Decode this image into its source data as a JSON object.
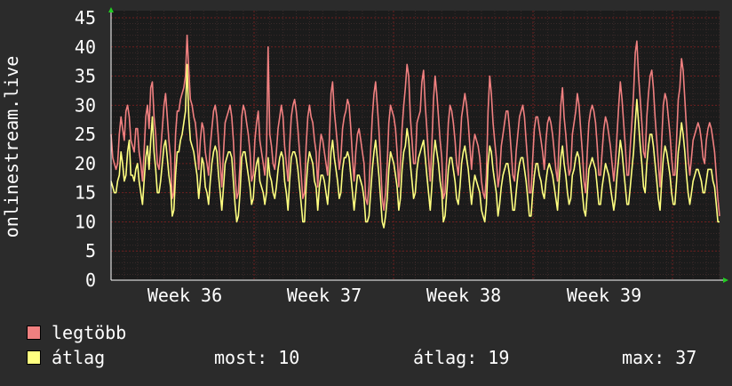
{
  "chart_data": {
    "type": "line",
    "ylabel": "onlinestream.live",
    "ylim": [
      0,
      45
    ],
    "yticks": [
      0,
      5,
      10,
      15,
      20,
      25,
      30,
      35,
      40,
      45
    ],
    "x_labels": [
      "Week 36",
      "Week 37",
      "Week 38",
      "Week 39"
    ],
    "grid": true,
    "colors": {
      "background": "#2b2b2b",
      "plot_background": "#1b1b1b",
      "major_grid": "#6e1f1f",
      "minor_grid": "#3a2a2a",
      "axis": "#ffffff",
      "axis_arrow": "#22cc22",
      "max_series": "#f08080",
      "avg_series": "#ffff80"
    },
    "series": [
      {
        "name": "legtöbb",
        "color": "#f08080",
        "values": [
          25,
          21,
          20,
          19,
          20,
          25,
          28,
          26,
          24,
          29,
          30,
          28,
          24,
          23,
          22,
          26,
          26,
          22,
          20,
          17,
          22,
          28,
          30,
          26,
          33,
          34,
          28,
          25,
          20,
          19,
          22,
          26,
          30,
          32,
          28,
          24,
          21,
          14,
          15,
          25,
          29,
          29,
          31,
          32,
          33,
          35,
          42,
          36,
          31,
          30,
          28,
          27,
          24,
          19,
          24,
          27,
          26,
          22,
          20,
          18,
          23,
          26,
          29,
          30,
          28,
          24,
          20,
          16,
          22,
          27,
          28,
          29,
          30,
          28,
          24,
          18,
          14,
          15,
          20,
          28,
          30,
          29,
          27,
          25,
          22,
          17,
          18,
          24,
          27,
          29,
          24,
          22,
          20,
          18,
          22,
          40,
          25,
          23,
          20,
          19,
          22,
          26,
          28,
          30,
          28,
          23,
          20,
          17,
          23,
          28,
          30,
          31,
          29,
          26,
          22,
          18,
          14,
          15,
          23,
          28,
          30,
          28,
          27,
          24,
          22,
          16,
          22,
          25,
          24,
          22,
          20,
          18,
          24,
          32,
          34,
          29,
          26,
          23,
          19,
          21,
          26,
          28,
          29,
          31,
          30,
          26,
          21,
          17,
          22,
          25,
          26,
          24,
          22,
          20,
          14,
          13,
          16,
          22,
          28,
          32,
          34,
          30,
          26,
          20,
          14,
          12,
          15,
          20,
          27,
          30,
          29,
          28,
          26,
          22,
          16,
          20,
          26,
          30,
          33,
          37,
          35,
          28,
          24,
          20,
          20,
          27,
          28,
          29,
          34,
          36,
          30,
          26,
          21,
          17,
          23,
          31,
          35,
          32,
          28,
          24,
          21,
          14,
          15,
          21,
          27,
          30,
          29,
          27,
          24,
          20,
          18,
          23,
          28,
          30,
          32,
          30,
          27,
          23,
          19,
          23,
          25,
          24,
          23,
          21,
          17,
          15,
          14,
          18,
          29,
          35,
          32,
          27,
          24,
          21,
          16,
          18,
          23,
          25,
          27,
          29,
          29,
          26,
          22,
          18,
          17,
          22,
          25,
          28,
          29,
          30,
          28,
          24,
          20,
          15,
          15,
          21,
          26,
          28,
          28,
          26,
          24,
          22,
          19,
          24,
          27,
          28,
          27,
          25,
          22,
          19,
          17,
          24,
          30,
          33,
          28,
          25,
          21,
          18,
          19,
          25,
          27,
          29,
          32,
          30,
          26,
          22,
          17,
          15,
          22,
          27,
          29,
          30,
          29,
          27,
          23,
          18,
          18,
          22,
          26,
          28,
          27,
          25,
          23,
          20,
          17,
          20,
          25,
          30,
          34,
          31,
          27,
          23,
          18,
          18,
          23,
          27,
          32,
          39,
          41,
          35,
          31,
          27,
          22,
          21,
          28,
          32,
          35,
          36,
          33,
          28,
          24,
          20,
          16,
          24,
          30,
          32,
          31,
          28,
          25,
          21,
          18,
          18,
          24,
          31,
          33,
          38,
          36,
          31,
          26,
          21,
          18,
          21,
          24,
          25,
          26,
          27,
          26,
          24,
          21,
          20,
          24,
          26,
          27,
          26,
          24,
          22,
          18,
          14,
          11
        ]
      },
      {
        "name": "átlag",
        "color": "#ffff80",
        "values": [
          17,
          16,
          15,
          15,
          17,
          18,
          22,
          20,
          17,
          18,
          22,
          24,
          18,
          18,
          17,
          19,
          20,
          17,
          15,
          13,
          17,
          21,
          23,
          19,
          24,
          28,
          22,
          19,
          15,
          15,
          17,
          20,
          23,
          24,
          21,
          18,
          16,
          11,
          12,
          18,
          22,
          22,
          24,
          25,
          27,
          29,
          37,
          28,
          24,
          23,
          22,
          20,
          18,
          14,
          17,
          21,
          20,
          16,
          15,
          13,
          17,
          20,
          22,
          23,
          22,
          18,
          15,
          12,
          16,
          20,
          21,
          22,
          22,
          21,
          17,
          13,
          10,
          11,
          15,
          21,
          22,
          22,
          20,
          18,
          16,
          13,
          14,
          18,
          20,
          21,
          17,
          16,
          15,
          13,
          15,
          21,
          18,
          17,
          15,
          14,
          16,
          19,
          21,
          22,
          21,
          17,
          15,
          12,
          17,
          21,
          22,
          22,
          21,
          19,
          16,
          13,
          10,
          10,
          16,
          20,
          22,
          21,
          20,
          17,
          16,
          12,
          16,
          18,
          18,
          17,
          15,
          13,
          17,
          22,
          24,
          21,
          19,
          17,
          14,
          15,
          19,
          21,
          21,
          22,
          21,
          18,
          15,
          12,
          15,
          18,
          18,
          17,
          16,
          14,
          10,
          10,
          11,
          15,
          19,
          22,
          24,
          21,
          18,
          14,
          10,
          9,
          11,
          14,
          19,
          22,
          21,
          20,
          18,
          16,
          12,
          14,
          19,
          22,
          23,
          26,
          24,
          20,
          17,
          14,
          15,
          19,
          21,
          22,
          23,
          24,
          21,
          18,
          15,
          12,
          16,
          21,
          24,
          22,
          20,
          17,
          15,
          10,
          11,
          15,
          19,
          21,
          21,
          19,
          17,
          14,
          13,
          16,
          20,
          22,
          23,
          21,
          19,
          16,
          13,
          16,
          18,
          17,
          16,
          15,
          12,
          11,
          10,
          13,
          20,
          23,
          22,
          19,
          17,
          15,
          11,
          13,
          16,
          18,
          19,
          20,
          20,
          18,
          15,
          12,
          12,
          15,
          18,
          20,
          21,
          21,
          19,
          17,
          14,
          11,
          11,
          15,
          18,
          20,
          20,
          18,
          17,
          15,
          14,
          17,
          19,
          20,
          19,
          18,
          16,
          14,
          12,
          17,
          21,
          23,
          20,
          18,
          15,
          13,
          14,
          18,
          19,
          21,
          22,
          21,
          18,
          15,
          12,
          11,
          15,
          19,
          20,
          21,
          20,
          19,
          16,
          13,
          13,
          16,
          18,
          20,
          19,
          18,
          16,
          14,
          12,
          14,
          18,
          21,
          24,
          22,
          19,
          16,
          13,
          13,
          16,
          19,
          22,
          27,
          31,
          27,
          23,
          20,
          16,
          15,
          20,
          23,
          25,
          25,
          23,
          20,
          17,
          14,
          12,
          17,
          21,
          23,
          22,
          20,
          18,
          15,
          13,
          13,
          17,
          22,
          24,
          27,
          25,
          22,
          18,
          15,
          13,
          15,
          17,
          18,
          19,
          19,
          18,
          17,
          15,
          15,
          17,
          19,
          19,
          19,
          17,
          16,
          13,
          10,
          10
        ]
      }
    ],
    "legend": {
      "max_label": "legtöbb",
      "avg_label": "átlag"
    },
    "stats": {
      "now": "most: 10",
      "avg": "átlag: 19",
      "max": "max: 37"
    }
  }
}
